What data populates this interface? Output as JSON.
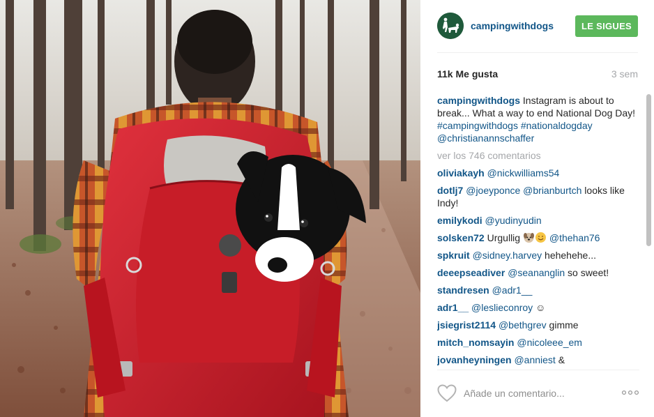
{
  "post": {
    "photo_icon": "hiker-with-puppy-backpack-photo",
    "header": {
      "username": "campingwithdogs",
      "avatar_icon": "camping-dogs-logo-icon",
      "follow_label": "LE SIGUES",
      "follow_color": "#5cb85c"
    },
    "stats": {
      "likes": "11k Me gusta",
      "time_ago": "3 sem"
    },
    "caption": {
      "username": "campingwithdogs",
      "text": " Instagram is about to break... What a way to end National Dog Day! ",
      "tags": "#campingwithdogs #nationaldogday @christianannschaffer"
    },
    "view_all": "ver los 746 comentarios",
    "comments": [
      {
        "user": "oliviakayh",
        "mention": "@nickwilliams54",
        "text": ""
      },
      {
        "user": "dotlj7",
        "mention": "@joeyponce @brianburtch",
        "text": " looks like Indy!"
      },
      {
        "user": "emilykodi",
        "mention": "@yudinyudin",
        "text": ""
      },
      {
        "user": "solsken72",
        "text_before": " Urgullig ",
        "mention": "@thehan76"
      },
      {
        "user": "spkruit",
        "mention": "@sidney.harvey",
        "text": " hehehehe..."
      },
      {
        "user": "deeepseadiver",
        "mention": "@seananglin",
        "text": " so sweet!"
      },
      {
        "user": "standresen",
        "mention": "@adr1__",
        "text": ""
      },
      {
        "user": "adr1__",
        "mention": "@leslieconroy",
        "text": " ☺"
      },
      {
        "user": "jsiegrist2114",
        "mention": "@bethgrev",
        "text": " gimme"
      },
      {
        "user": "mitch_nomsayin",
        "mention": "@nicoleee_em",
        "text": ""
      },
      {
        "user": "jovanheyningen",
        "mention": "@anniest",
        "text": " &"
      }
    ],
    "comment_input": {
      "placeholder": "Añade un comentario..."
    },
    "icons": {
      "like": "heart-outline-icon",
      "more": "more-options-icon"
    }
  }
}
